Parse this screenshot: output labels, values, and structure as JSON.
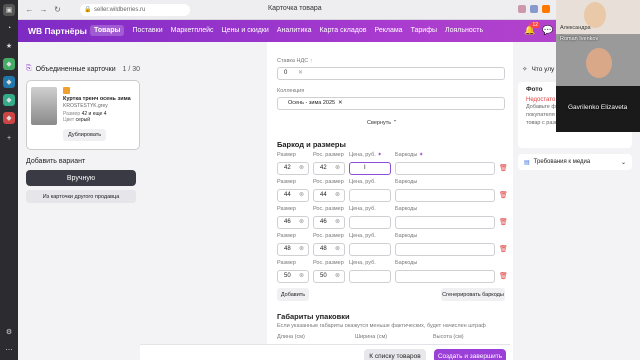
{
  "browser": {
    "url": "seller.wildberries.ru",
    "tab_title": "Карточка товара"
  },
  "header": {
    "logo": "WB Партнёры",
    "menu": [
      "Товары",
      "Поставки",
      "Маркетплейс",
      "Цены и скидки",
      "Аналитика",
      "Карта складов",
      "Реклама",
      "Тарифы",
      "Лояльность"
    ],
    "active_menu": "Товары",
    "notifications": "12"
  },
  "left": {
    "united_cards_label": "Объединенные карточки",
    "count": "1 / 30",
    "product": {
      "name": "Куртка тренч осень зима",
      "code": "KROSTESTYK.grey",
      "size_label": "Размер",
      "size_value": "42 и еще 4",
      "color_label": "Цвет",
      "color_value": "серый",
      "duplicate_label": "Дублировать"
    },
    "add_variant": "Добавить вариант",
    "manual_button": "Вручную",
    "from_other_button": "Из карточки другого продавца"
  },
  "form": {
    "vat_label": "Ставка НДС",
    "vat_value": "0",
    "collection_label": "Коллекция",
    "collection_value": "Осень - зима 2025",
    "collapse_label": "Свернуть",
    "barcode_section_title": "Баркод и размеры",
    "col_size": "Размер",
    "col_ru_size": "Рос. размер",
    "col_price": "Цена, руб.",
    "col_barcodes": "Баркоды",
    "rows": [
      {
        "size": "42",
        "ru_size": "42",
        "price": "",
        "barcode": ""
      },
      {
        "size": "44",
        "ru_size": "44",
        "price": "",
        "barcode": ""
      },
      {
        "size": "46",
        "ru_size": "46",
        "price": "",
        "barcode": ""
      },
      {
        "size": "48",
        "ru_size": "48",
        "price": "",
        "barcode": ""
      },
      {
        "size": "50",
        "ru_size": "50",
        "price": "",
        "barcode": ""
      }
    ],
    "add_button": "Добавить",
    "generate_button": "Сгенерировать баркоды",
    "package_title": "Габариты упаковки",
    "package_hint": "Если указанные габариты окажутся меньше фактических, будет начислен штраф",
    "length_label": "Длина (см)",
    "width_label": "Ширина (см)",
    "height_label": "Высота (см)"
  },
  "bottom": {
    "to_list": "К списку товаров",
    "create": "Создать и завершить"
  },
  "right": {
    "what_improve": "Что улу",
    "photo_title": "Фото",
    "photo_warning": "Недостато",
    "photo_desc1": "Добавьте ф",
    "photo_desc2": "покупателя",
    "photo_desc3": "товар с разн",
    "media_req": "Требования к медиа"
  },
  "video": {
    "p1": "Александра",
    "p2": "Roman Ivenkov",
    "p3": "Gavrilenko Elizaveta"
  },
  "colors": {
    "brand": "#9a3fd8",
    "header_start": "#7d2bc4",
    "danger": "#e04040"
  }
}
